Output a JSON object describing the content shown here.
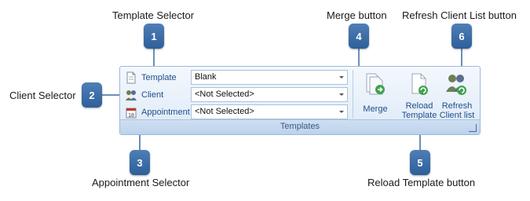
{
  "captions": {
    "template_selector": "Template Selector",
    "merge_button": "Merge button",
    "refresh_client_list_button": "Refresh Client List button",
    "client_selector": "Client Selector",
    "appointment_selector": "Appointment Selector",
    "reload_template_button": "Reload Template button"
  },
  "callouts": {
    "c1": "1",
    "c2": "2",
    "c3": "3",
    "c4": "4",
    "c5": "5",
    "c6": "6"
  },
  "ribbon": {
    "rows": [
      {
        "label": "Template",
        "value": "Blank",
        "icon": "document-icon"
      },
      {
        "label": "Client",
        "value": "<Not Selected>",
        "icon": "people-icon"
      },
      {
        "label": "Appointment",
        "value": "<Not Selected>",
        "icon": "calendar-icon"
      }
    ],
    "merge_label": "Merge",
    "reload_label_1": "Reload",
    "reload_label_2": "Template",
    "refresh_label_1": "Refresh",
    "refresh_label_2": "Client list",
    "group_title": "Templates",
    "launcher_glyph": "↘"
  },
  "colors": {
    "callout": "#3a6ea8",
    "ribbon_bg": "#dde9f7",
    "label_blue": "#1f4e8c"
  }
}
